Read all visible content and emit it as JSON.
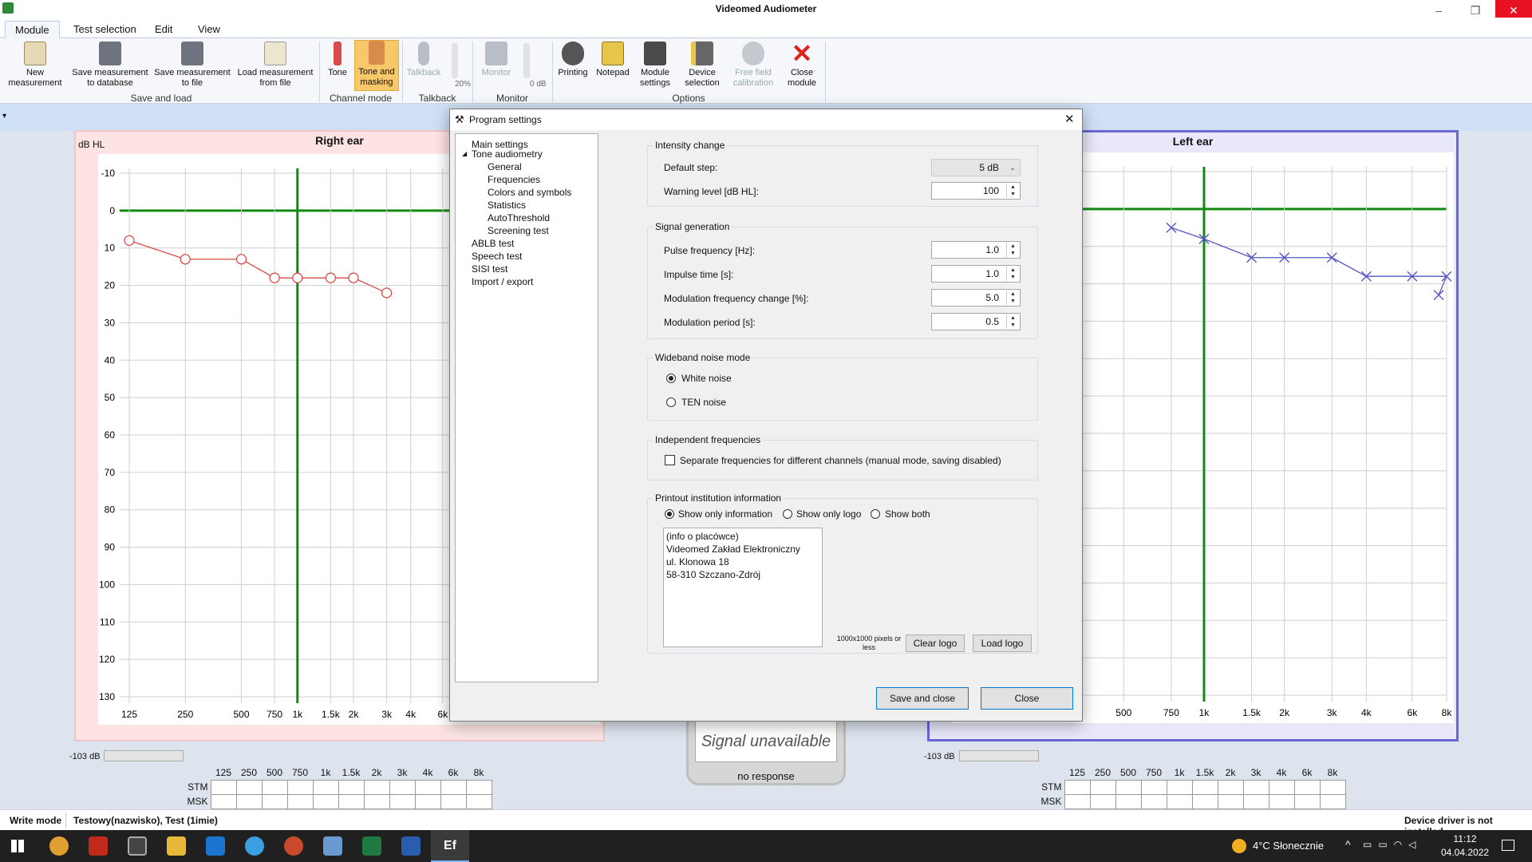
{
  "window": {
    "title": "Videomed Audiometer"
  },
  "tabs": [
    "Module",
    "Test selection",
    "Edit",
    "View"
  ],
  "ribbon": {
    "buttons": [
      {
        "id": "new",
        "label": "New\nmeasurement"
      },
      {
        "id": "savedb",
        "label": "Save measurement\nto database"
      },
      {
        "id": "savefile",
        "label": "Save measurement\nto file"
      },
      {
        "id": "load",
        "label": "Load measurement\nfrom file"
      },
      {
        "id": "tone",
        "label": "Tone"
      },
      {
        "id": "tonemask",
        "label": "Tone and\nmasking"
      },
      {
        "id": "talkback",
        "label": "Talkback"
      },
      {
        "id": "monitor",
        "label": "Monitor"
      },
      {
        "id": "printing",
        "label": "Printing"
      },
      {
        "id": "notepad",
        "label": "Notepad"
      },
      {
        "id": "modset",
        "label": "Module\nsettings"
      },
      {
        "id": "devsel",
        "label": "Device\nselection"
      },
      {
        "id": "freefield",
        "label": "Free field\ncalibration"
      },
      {
        "id": "closemod",
        "label": "Close\nmodule"
      }
    ],
    "groups": [
      "Save and load",
      "Channel mode",
      "Talkback",
      "Monitor",
      "Options"
    ],
    "talkback_pct": "20%",
    "monitor_db": "0 dB"
  },
  "audiogram": {
    "y_unit": "dB HL",
    "y_ticks": [
      "-10",
      "0",
      "10",
      "20",
      "30",
      "40",
      "50",
      "60",
      "70",
      "80",
      "90",
      "100",
      "110",
      "120",
      "130"
    ],
    "x_ticks": [
      "125",
      "250",
      "500",
      "750",
      "1k",
      "1.5k",
      "2k",
      "3k",
      "4k",
      "6k",
      "8k"
    ],
    "x_unit": "Hz",
    "right": {
      "title": "Right ear",
      "color": "#d94b4b",
      "points": [
        {
          "f": "125",
          "db": 8
        },
        {
          "f": "250",
          "db": 13
        },
        {
          "f": "500",
          "db": 13
        },
        {
          "f": "750",
          "db": 18
        },
        {
          "f": "1k",
          "db": 18
        },
        {
          "f": "1.5k",
          "db": 18
        },
        {
          "f": "2k",
          "db": 18
        },
        {
          "f": "3k",
          "db": 22
        }
      ]
    },
    "left": {
      "title": "Left ear",
      "color": "#5454c8",
      "points": [
        {
          "f": "750",
          "db": 5
        },
        {
          "f": "1k",
          "db": 8
        },
        {
          "f": "1.5k",
          "db": 13
        },
        {
          "f": "2k",
          "db": 13
        },
        {
          "f": "3k",
          "db": 13
        },
        {
          "f": "4k",
          "db": 18
        },
        {
          "f": "6k",
          "db": 18
        },
        {
          "f": "8k",
          "db": 18
        }
      ],
      "tail": {
        "db": 23
      }
    }
  },
  "level": {
    "right": "-103 dB",
    "left": "-103 dB"
  },
  "freqTable": {
    "freqs": [
      "125",
      "250",
      "500",
      "750",
      "1k",
      "1.5k",
      "2k",
      "3k",
      "4k",
      "6k",
      "8k"
    ],
    "rows": [
      "STM",
      "MSK"
    ]
  },
  "signal": {
    "text": "Signal unavailable",
    "sub": "no response"
  },
  "dialog": {
    "title": "Program settings",
    "tree": [
      "Main settings",
      "Tone audiometry",
      "General",
      "Frequencies",
      "Colors and symbols",
      "Statistics",
      "AutoThreshold",
      "Screening test",
      "ABLB test",
      "Speech test",
      "SISI test",
      "Import / export"
    ],
    "intensity": {
      "legend": "Intensity change",
      "default_step_label": "Default step:",
      "default_step": "5 dB",
      "warning_label": "Warning level [dB HL]:",
      "warning": "100"
    },
    "signal": {
      "legend": "Signal generation",
      "pulse_label": "Pulse frequency [Hz]:",
      "pulse": "1.0",
      "impulse_label": "Impulse time [s]:",
      "impulse": "1.0",
      "modchange_label": "Modulation frequency change [%]:",
      "modchange": "5.0",
      "modperiod_label": "Modulation period [s]:",
      "modperiod": "0.5"
    },
    "noise": {
      "legend": "Wideband noise mode",
      "white": "White noise",
      "ten": "TEN noise"
    },
    "indep": {
      "legend": "Independent frequencies",
      "label": "Separate frequencies for different channels (manual mode, saving disabled)"
    },
    "printout": {
      "legend": "Printout institution information",
      "opt1": "Show only information",
      "opt2": "Show only logo",
      "opt3": "Show both",
      "lines": [
        "(info o placówce)",
        "Videomed Zakład Elektroniczny",
        "ul. Klonowa 18",
        "58-310 Szczano-Zdrój"
      ],
      "logo_note": "1000x1000 pixels or less",
      "clear": "Clear logo",
      "load": "Load logo"
    },
    "save_close": "Save and close",
    "close": "Close"
  },
  "status": {
    "left": "Write mode",
    "patient": "Testowy(nazwisko), Test (1imie)",
    "right": "Device driver is not installed"
  },
  "taskbar": {
    "weather": "4°C  Słonecznie",
    "time": "11:12",
    "date": "04.04.2022"
  }
}
